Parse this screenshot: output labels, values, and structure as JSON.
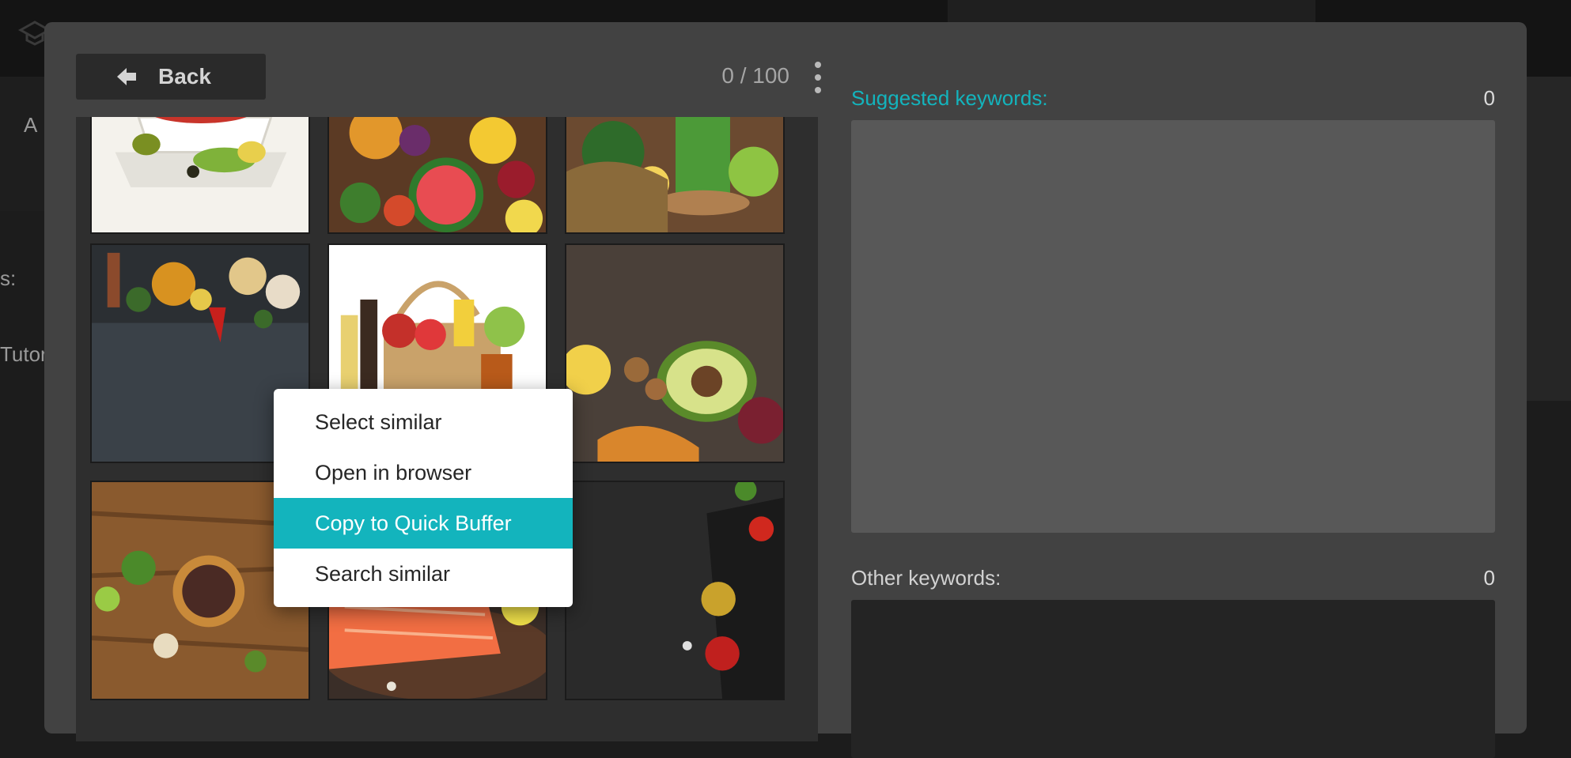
{
  "background": {
    "partial_labels": [
      "A",
      "s:",
      "Tutor"
    ]
  },
  "modal": {
    "back_label": "Back",
    "counter": "0 / 100",
    "more_icon": "more-vertical-icon",
    "images": [
      {
        "name": "salad-plate-image"
      },
      {
        "name": "fruits-vegetables-image"
      },
      {
        "name": "green-smoothie-image"
      },
      {
        "name": "spices-slate-image"
      },
      {
        "name": "grocery-basket-image"
      },
      {
        "name": "avocado-nuts-image"
      },
      {
        "name": "peppercorns-wood-image"
      },
      {
        "name": "salmon-board-image"
      },
      {
        "name": "cutting-board-dark-image"
      }
    ]
  },
  "keywords": {
    "suggested_label": "Suggested keywords:",
    "suggested_count": "0",
    "other_label": "Other keywords:",
    "other_count": "0"
  },
  "context_menu": {
    "items": [
      {
        "label": "Select similar",
        "active": false
      },
      {
        "label": "Open in browser",
        "active": false
      },
      {
        "label": "Copy to Quick Buffer",
        "active": true
      },
      {
        "label": "Search similar",
        "active": false
      }
    ]
  },
  "colors": {
    "accent": "#13b4bd",
    "modal_bg": "#424242",
    "suggested_box": "#585858",
    "other_box": "#242424"
  }
}
